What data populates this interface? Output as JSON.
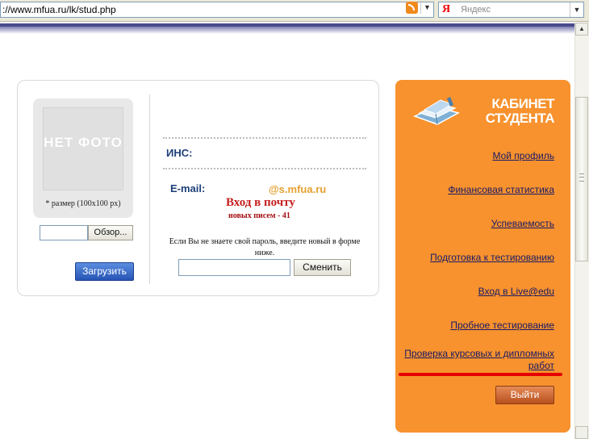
{
  "browser": {
    "url": "://www.mfua.ru/lk/stud.php",
    "search_engine_letter": "Я",
    "search_placeholder": "Яндекс",
    "icons": {
      "feed": "rss-icon",
      "search_engine": "yandex-icon"
    }
  },
  "profile": {
    "photo_placeholder": "НЕТ ФОТО",
    "size_note": "* размер (100x100 px)",
    "browse_label": "Обзор...",
    "upload_label": "Загрузить"
  },
  "info": {
    "inn_label": "ИНС:",
    "email_label": "E-mail:",
    "email_domain": "@s.mfua.ru",
    "mail_link": "Вход в почту",
    "new_mail": "новых писем - 41",
    "password_note": "Если Вы не знаете свой пароль, введите новый в форме ниже.",
    "change_label": "Сменить"
  },
  "sidebar": {
    "title": "КАБИНЕТ СТУДЕНТА",
    "icon": "books-icon",
    "items": [
      {
        "label": "Мой профиль"
      },
      {
        "label": "Финансовая статистика"
      },
      {
        "label": "Успеваемость"
      },
      {
        "label": "Подготовка к тестированию"
      },
      {
        "label": "Вход в Live@edu"
      },
      {
        "label": "Пробное тестирование"
      },
      {
        "label": "Проверка курсовых и дипломных работ"
      }
    ],
    "logout_label": "Выйти"
  },
  "colors": {
    "sidebar_bg": "#f7922e",
    "link": "#1a1a66",
    "heading": "#1d3f78",
    "mail_link": "#c41d1d",
    "highlight": "#e60000"
  }
}
